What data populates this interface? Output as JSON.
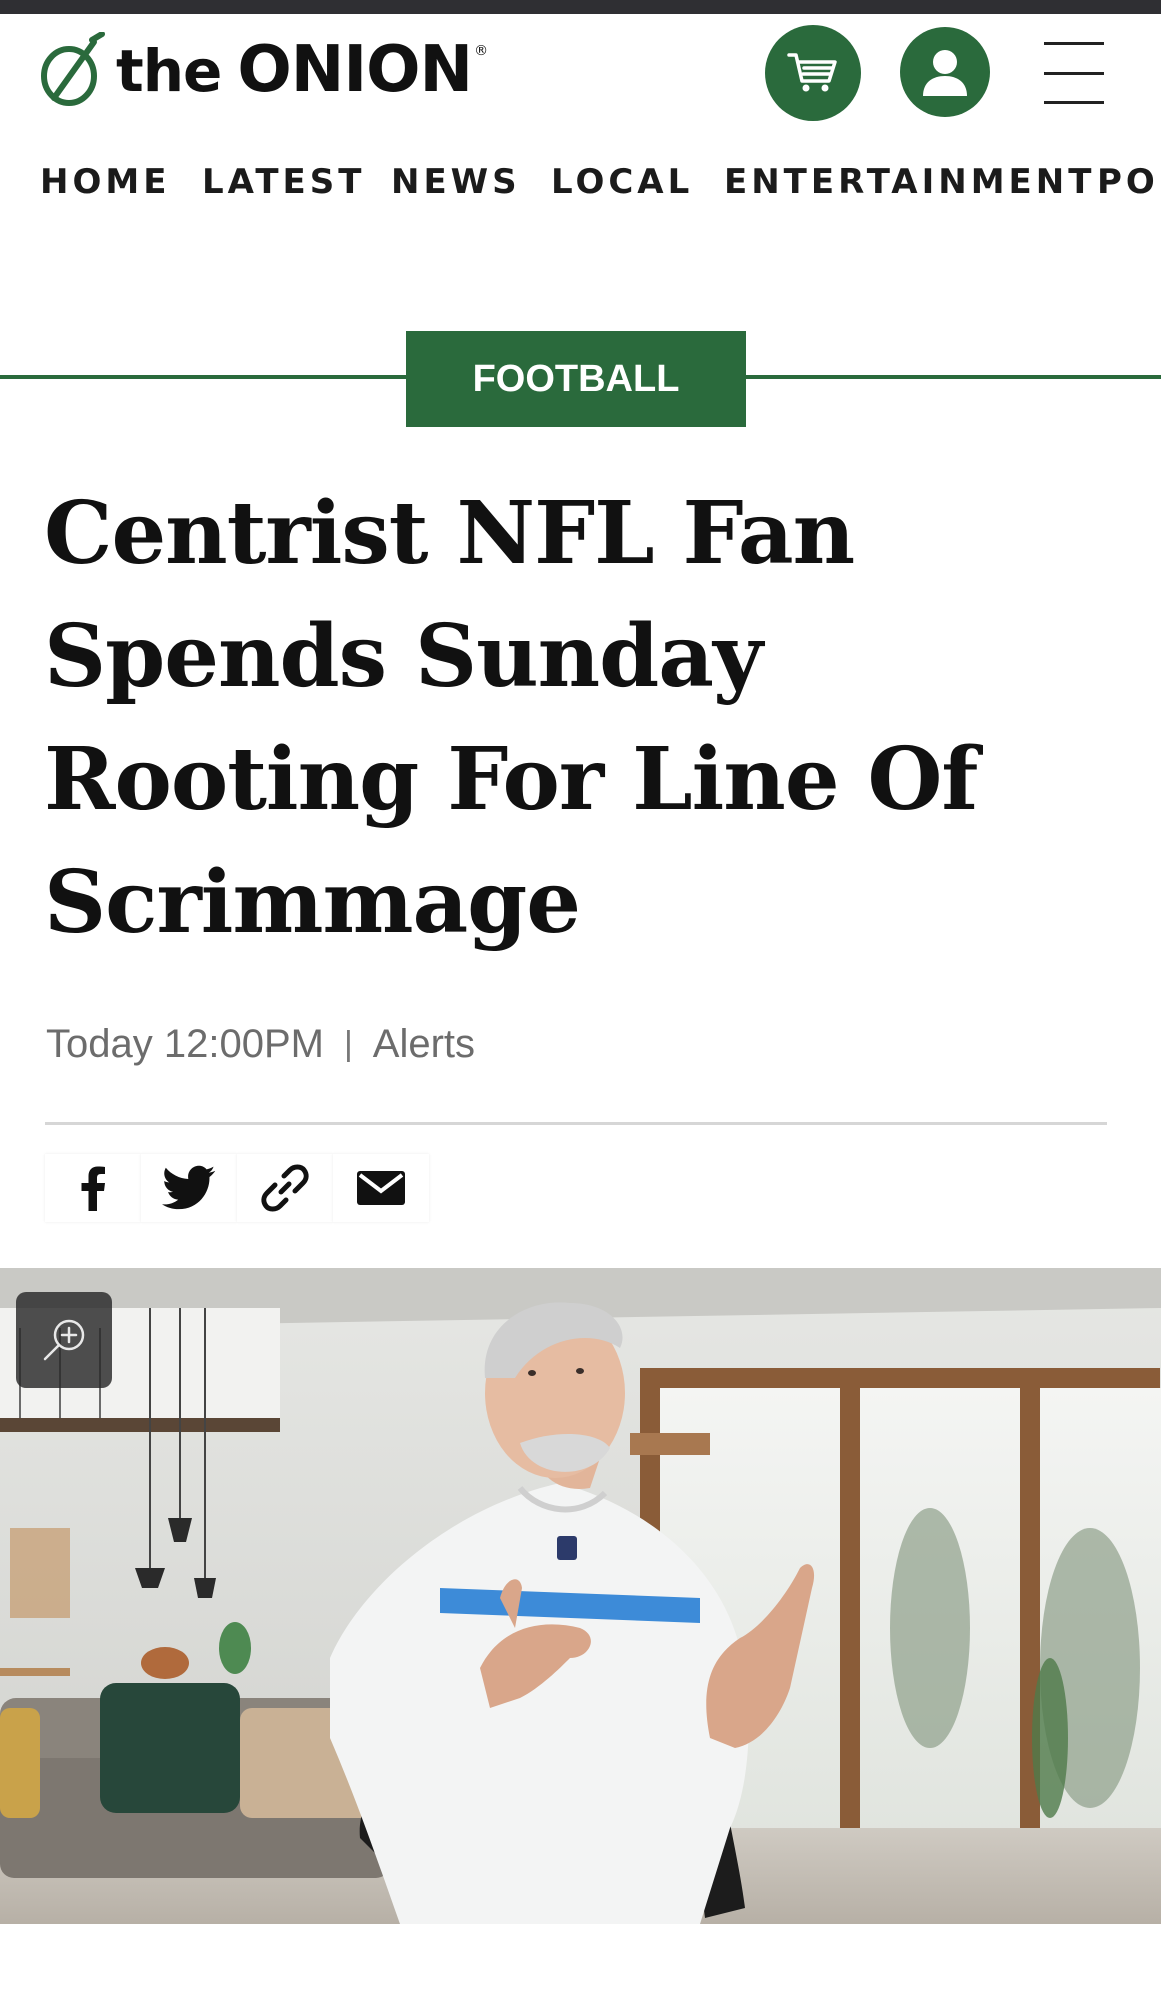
{
  "header": {
    "logo_the": "the",
    "logo_onion": "ONION",
    "logo_reg": "®",
    "icons": {
      "logo": "onion-logo-icon",
      "cart": "cart-icon",
      "user": "user-icon",
      "menu": "hamburger-menu-icon"
    },
    "brand_color": "#2a6a3c"
  },
  "nav": {
    "items": [
      {
        "label": "HOME"
      },
      {
        "label": "LATEST"
      },
      {
        "label": "NEWS"
      },
      {
        "label": "LOCAL"
      },
      {
        "label": "ENTERTAINMENT"
      },
      {
        "label": "POL"
      }
    ]
  },
  "article": {
    "category": "FOOTBALL",
    "headline": "Centrist NFL Fan Spends Sunday Rooting For Line Of Scrimmage",
    "date": "Today 12:00PM",
    "separator": "|",
    "alerts": "Alerts"
  },
  "share": {
    "icons": [
      "facebook-icon",
      "twitter-icon",
      "link-icon",
      "email-icon"
    ]
  },
  "hero": {
    "zoom_icon": "zoom-in-icon"
  }
}
